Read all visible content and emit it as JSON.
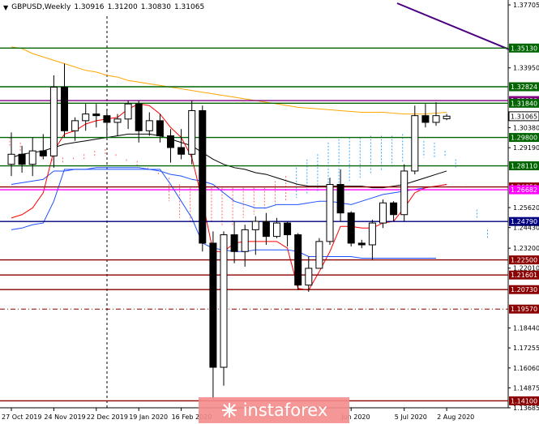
{
  "header": {
    "symbol": "GBPUSD,Weekly",
    "open": "1.30916",
    "high": "1.31200",
    "low": "1.30830",
    "close": "1.31065"
  },
  "watermark": "instaforex",
  "chart_data": {
    "type": "candlestick",
    "ylim": [
      1.13685,
      1.37705
    ],
    "y_ticks": [
      "1.37705",
      "1.33950",
      "1.30380",
      "1.29190",
      "1.25620",
      "1.24430",
      "1.23200",
      "1.22010",
      "1.18440",
      "1.17255",
      "1.16060",
      "1.14875",
      "1.13685"
    ],
    "x_ticks": [
      {
        "label": "27 Oct 2019",
        "i": 0
      },
      {
        "label": "24 Nov 2019",
        "i": 4
      },
      {
        "label": "22 Dec 2019",
        "i": 8
      },
      {
        "label": "19 Jan 2020",
        "i": 12
      },
      {
        "label": "16 Feb 2020",
        "i": 16
      },
      {
        "label": "Jun 2020",
        "i": 32
      },
      {
        "label": "5 Jul 2020",
        "i": 37
      },
      {
        "label": "2 Aug 2020",
        "i": 41
      }
    ],
    "levels": [
      {
        "value": 1.3513,
        "label": "1.35130",
        "color": "#006400"
      },
      {
        "value": 1.32824,
        "label": "1.32824",
        "color": "#006400"
      },
      {
        "value": 1.32,
        "label": "1.32000",
        "color": "#800080"
      },
      {
        "value": 1.3184,
        "label": "1.31840",
        "color": "#006400"
      },
      {
        "value": 1.31065,
        "label": "1.31065",
        "color": "#ffffff"
      },
      {
        "value": 1.298,
        "label": "1.29800",
        "color": "#006400"
      },
      {
        "value": 1.2811,
        "label": "1.28110",
        "color": "#006400"
      },
      {
        "value": 1.2685,
        "label": "1.26850",
        "color": "#8b0000"
      },
      {
        "value": 1.26682,
        "label": "1.26682",
        "color": "#ff00ff"
      },
      {
        "value": 1.2479,
        "label": "1.24790",
        "color": "#000080"
      },
      {
        "value": 1.225,
        "label": "1.22500",
        "color": "#8b0000"
      },
      {
        "value": 1.21601,
        "label": "1.21601",
        "color": "#8b0000"
      },
      {
        "value": 1.2073,
        "label": "1.20730",
        "color": "#8b0000"
      },
      {
        "value": 1.1957,
        "label": "1.19570",
        "color": "#8b0000"
      },
      {
        "value": 1.141,
        "label": "1.14100",
        "color": "#8b0000"
      }
    ],
    "candles": [
      [
        1.282,
        1.301,
        1.275,
        1.288
      ],
      [
        1.288,
        1.293,
        1.277,
        1.282
      ],
      [
        1.282,
        1.298,
        1.275,
        1.29
      ],
      [
        1.29,
        1.3,
        1.285,
        1.287
      ],
      [
        1.287,
        1.335,
        1.28,
        1.328
      ],
      [
        1.328,
        1.342,
        1.298,
        1.302
      ],
      [
        1.302,
        1.31,
        1.296,
        1.308
      ],
      [
        1.308,
        1.318,
        1.302,
        1.312
      ],
      [
        1.312,
        1.318,
        1.304,
        1.311
      ],
      [
        1.311,
        1.315,
        1.298,
        1.307
      ],
      [
        1.307,
        1.312,
        1.299,
        1.309
      ],
      [
        1.309,
        1.32,
        1.303,
        1.318
      ],
      [
        1.318,
        1.32,
        1.295,
        1.302
      ],
      [
        1.302,
        1.313,
        1.299,
        1.308
      ],
      [
        1.308,
        1.312,
        1.295,
        1.299
      ],
      [
        1.299,
        1.303,
        1.283,
        1.292
      ],
      [
        1.292,
        1.303,
        1.285,
        1.288
      ],
      [
        1.288,
        1.32,
        1.282,
        1.314
      ],
      [
        1.314,
        1.317,
        1.23,
        1.235
      ],
      [
        1.235,
        1.242,
        1.142,
        1.161
      ],
      [
        1.161,
        1.242,
        1.15,
        1.24
      ],
      [
        1.24,
        1.248,
        1.223,
        1.23
      ],
      [
        1.23,
        1.246,
        1.221,
        1.243
      ],
      [
        1.243,
        1.251,
        1.228,
        1.248
      ],
      [
        1.248,
        1.253,
        1.234,
        1.239
      ],
      [
        1.239,
        1.25,
        1.238,
        1.247
      ],
      [
        1.247,
        1.248,
        1.233,
        1.24
      ],
      [
        1.24,
        1.241,
        1.207,
        1.21
      ],
      [
        1.21,
        1.227,
        1.206,
        1.22
      ],
      [
        1.22,
        1.238,
        1.22,
        1.236
      ],
      [
        1.236,
        1.274,
        1.234,
        1.27
      ],
      [
        1.27,
        1.279,
        1.248,
        1.253
      ],
      [
        1.253,
        1.254,
        1.233,
        1.235
      ],
      [
        1.235,
        1.237,
        1.232,
        1.234
      ],
      [
        1.234,
        1.249,
        1.225,
        1.247
      ],
      [
        1.247,
        1.261,
        1.244,
        1.259
      ],
      [
        1.259,
        1.26,
        1.248,
        1.252
      ],
      [
        1.252,
        1.282,
        1.248,
        1.278
      ],
      [
        1.278,
        1.317,
        1.276,
        1.311
      ],
      [
        1.311,
        1.318,
        1.304,
        1.307
      ],
      [
        1.307,
        1.319,
        1.305,
        1.311
      ],
      [
        1.3092,
        1.312,
        1.3083,
        1.3107
      ]
    ]
  }
}
